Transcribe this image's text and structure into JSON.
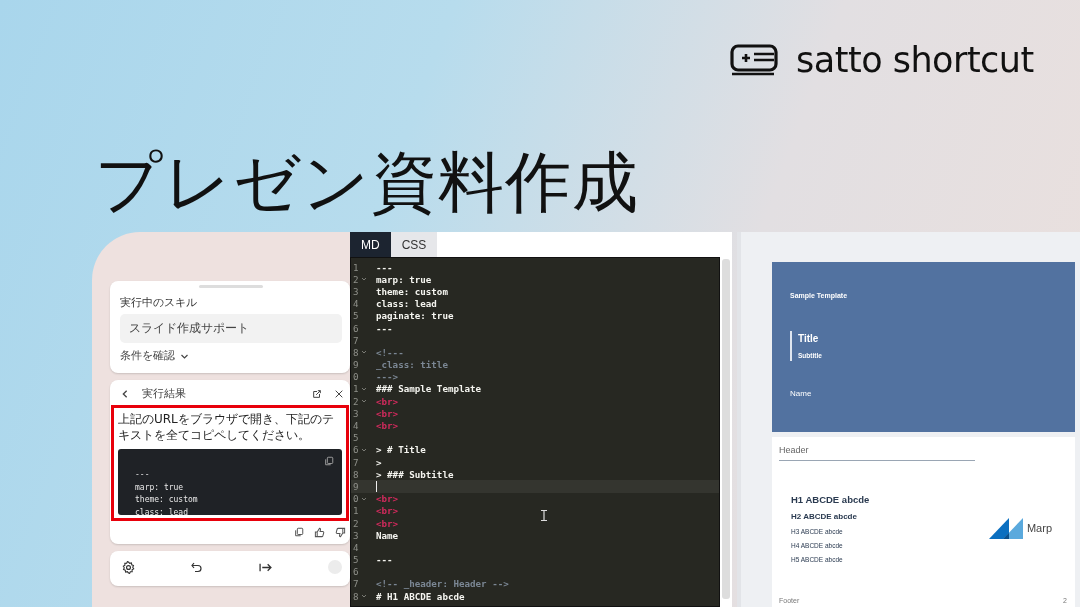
{
  "brand": {
    "name": "satto shortcut"
  },
  "headline": "プレゼン資料作成",
  "assistant": {
    "skill_label": "実行中のスキル",
    "skill_name": "スライド作成サポート",
    "conditions_toggle": "条件を確認",
    "conditions_expanded": false,
    "result": {
      "title": "実行結果",
      "highlighted": true,
      "message": "上記のURLをブラウザで開き、下記のテキストを全てコピペしてください。",
      "code_lines": [
        "---",
        "marp: true",
        "theme: custom",
        "class: lead"
      ]
    }
  },
  "editor": {
    "tabs": [
      {
        "label": "MD",
        "selected": true
      },
      {
        "label": "CSS",
        "selected": false
      }
    ],
    "lines": [
      {
        "number": "1",
        "text": "---",
        "kind": "plain",
        "foldable": false,
        "active": false
      },
      {
        "number": "2",
        "text": "marp: true",
        "kind": "plain",
        "foldable": true,
        "active": false
      },
      {
        "number": "3",
        "text": "theme: custom",
        "kind": "plain",
        "foldable": false,
        "active": false
      },
      {
        "number": "4",
        "text": "class: lead",
        "kind": "plain",
        "foldable": false,
        "active": false
      },
      {
        "number": "5",
        "text": "paginate: true",
        "kind": "plain",
        "foldable": false,
        "active": false
      },
      {
        "number": "6",
        "text": "---",
        "kind": "plain",
        "foldable": false,
        "active": false
      },
      {
        "number": "7",
        "foldable": false,
        "active": false
      },
      {
        "number": "8",
        "text": "<!---",
        "kind": "comment",
        "foldable": true,
        "active": false
      },
      {
        "number": "9",
        "text": "_class: title",
        "kind": "comment",
        "foldable": false,
        "active": false
      },
      {
        "number": "0",
        "text": "--->",
        "kind": "comment",
        "foldable": false,
        "active": false
      },
      {
        "number": "1",
        "text": "### Sample Template",
        "kind": "plain",
        "foldable": true,
        "active": false
      },
      {
        "number": "2",
        "text": "<br>",
        "kind": "tag",
        "foldable": true,
        "active": false
      },
      {
        "number": "3",
        "text": "<br>",
        "kind": "tag",
        "foldable": false,
        "active": false
      },
      {
        "number": "4",
        "text": "<br>",
        "kind": "tag",
        "foldable": false,
        "active": false
      },
      {
        "number": "5",
        "foldable": false,
        "active": false
      },
      {
        "number": "6",
        "text": "> # Title",
        "kind": "plain",
        "foldable": true,
        "active": false
      },
      {
        "number": "7",
        "text": ">",
        "kind": "plain",
        "foldable": false,
        "active": false
      },
      {
        "number": "8",
        "text": "> ### Subtitle",
        "kind": "plain",
        "foldable": false,
        "active": false
      },
      {
        "number": "9",
        "foldable": false,
        "active": true
      },
      {
        "number": "0",
        "text": "<br>",
        "kind": "tag",
        "foldable": true,
        "active": false
      },
      {
        "number": "1",
        "text": "<br>",
        "kind": "tag",
        "foldable": false,
        "active": false
      },
      {
        "number": "2",
        "text": "<br>",
        "kind": "tag",
        "foldable": false,
        "active": false
      },
      {
        "number": "3",
        "text": "Name",
        "kind": "plain",
        "foldable": false,
        "active": false
      },
      {
        "number": "4",
        "foldable": false,
        "active": false
      },
      {
        "number": "5",
        "text": "---",
        "kind": "plain",
        "foldable": false,
        "active": false
      },
      {
        "number": "6",
        "foldable": false,
        "active": false
      },
      {
        "number": "7",
        "text": "<!-- _header: Header -->",
        "kind": "comment",
        "foldable": false,
        "active": false
      },
      {
        "number": "8",
        "text": "# H1 ABCDE abcde",
        "kind": "plain",
        "foldable": true,
        "active": false
      }
    ]
  },
  "preview": {
    "slides": [
      {
        "kind": "title",
        "heading": "Sample Template",
        "title": "Title",
        "subtitle": "Subtitle",
        "author": "Name"
      },
      {
        "kind": "content",
        "header": "Header",
        "headings": [
          "H1 ABCDE abcde",
          "H2 ABCDE abcde",
          "H3 ABCDE abcde",
          "H4 ABCDE abcde",
          "H5 ABCDE abcde"
        ],
        "logo_text": "Marp",
        "footer": "Footer",
        "page": "2"
      }
    ]
  }
}
